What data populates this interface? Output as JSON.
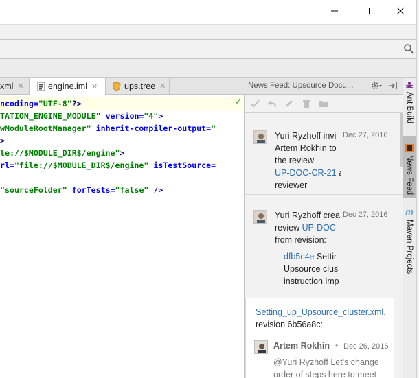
{
  "window": {
    "minimize": "minimize",
    "maximize": "maximize",
    "close": "close"
  },
  "editor_tabs": [
    {
      "label": "xml",
      "icon": "xml-file-icon",
      "active": false
    },
    {
      "label": "engine.iml",
      "icon": "iml-file-icon",
      "active": true
    },
    {
      "label": "ups.tree",
      "icon": "tree-file-icon",
      "active": false
    }
  ],
  "tab_close_glyph": "✕",
  "code": {
    "line0": [
      "ncoding=",
      "\"UTF-8\"",
      "?>"
    ],
    "line1": [
      "TATION_ENGINE_MODULE\"",
      " version=",
      "\"4\"",
      ">"
    ],
    "line2": [
      "wModuleRootManager\"",
      " inherit-compiler-output=",
      "\""
    ],
    "line3": [
      ">"
    ],
    "line4": [
      "le://$MODULE_DIR$/engine\"",
      ">"
    ],
    "line5": [
      "rl=",
      "\"file://$MODULE_DIR$/engine\"",
      " isTestSource="
    ],
    "line6": [
      "\"sourceFolder\"",
      " forTests=",
      "\"false\"",
      " />"
    ]
  },
  "news_feed": {
    "title": "News Feed: Upsource Docu...",
    "items": [
      {
        "avatar": "yuri-ryzhoff-avatar",
        "lines": [
          "Yuri Ryzhoff invi",
          "Artem Rokhin to",
          "the review"
        ],
        "link": "UP-DOC-CR-21",
        "link_suffix": "a",
        "tail": "reviewer",
        "date": "Dec 27, 2016"
      },
      {
        "avatar": "yuri-ryzhoff-avatar",
        "line1": "Yuri Ryzhoff crea",
        "line2_prefix": "review ",
        "line2_link": "UP-DOC-",
        "line3": "from revision:",
        "rev_link": "dfb5c4e",
        "rev_text": " Settir",
        "rev_line2": "Upsource clus",
        "rev_line3": "instruction imp",
        "date": "Dec 27, 2016"
      },
      {
        "file_link": "Setting_up_Upsource_cluster.xml,",
        "revision": "revision 6b56a8c:",
        "author": "Artem Rokhin",
        "separator": "•",
        "date": "Dec 26, 2016",
        "comment1": "@Yuri Ryzhoff Let's change",
        "comment2": "order of steps here to meet"
      }
    ]
  },
  "tool_windows": [
    {
      "label": "Ant Build",
      "icon": "ant-icon",
      "active": false
    },
    {
      "label": "News Feed",
      "icon": "upsource-icon",
      "active": true
    },
    {
      "label": "Maven Projects",
      "icon": "maven-icon",
      "active": false
    }
  ],
  "colors": {
    "link": "#2a6db6",
    "xml_tag": "#000080",
    "xml_attr": "#0000ff",
    "xml_value": "#008000"
  }
}
